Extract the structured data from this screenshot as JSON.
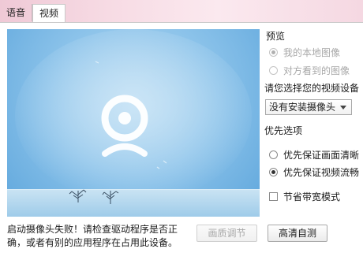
{
  "tabs": [
    {
      "label": "语音",
      "active": false
    },
    {
      "label": "视频",
      "active": true
    }
  ],
  "preview": {
    "icon": "webcam-icon"
  },
  "panel": {
    "preview_title": "预览",
    "preview_options": [
      {
        "label": "我的本地图像",
        "checked": true,
        "disabled": true
      },
      {
        "label": "对方看到的图像",
        "checked": false,
        "disabled": true
      }
    ],
    "device_prompt": "请您选择您的视频设备",
    "device_selected": "没有安装摄像头",
    "priority_title": "优先选项",
    "priority_options": [
      {
        "label": "优先保证画面清晰",
        "checked": false
      },
      {
        "label": "优先保证视频流畅",
        "checked": true
      }
    ],
    "bandwidth_label": "节省带宽模式",
    "bandwidth_checked": false
  },
  "status": {
    "message": "启动摄像头失败！请检查驱动程序是否正确，或者有别的应用程序在占用此设备。"
  },
  "buttons": {
    "quality": "画质调节",
    "hd_test": "高清自测"
  }
}
